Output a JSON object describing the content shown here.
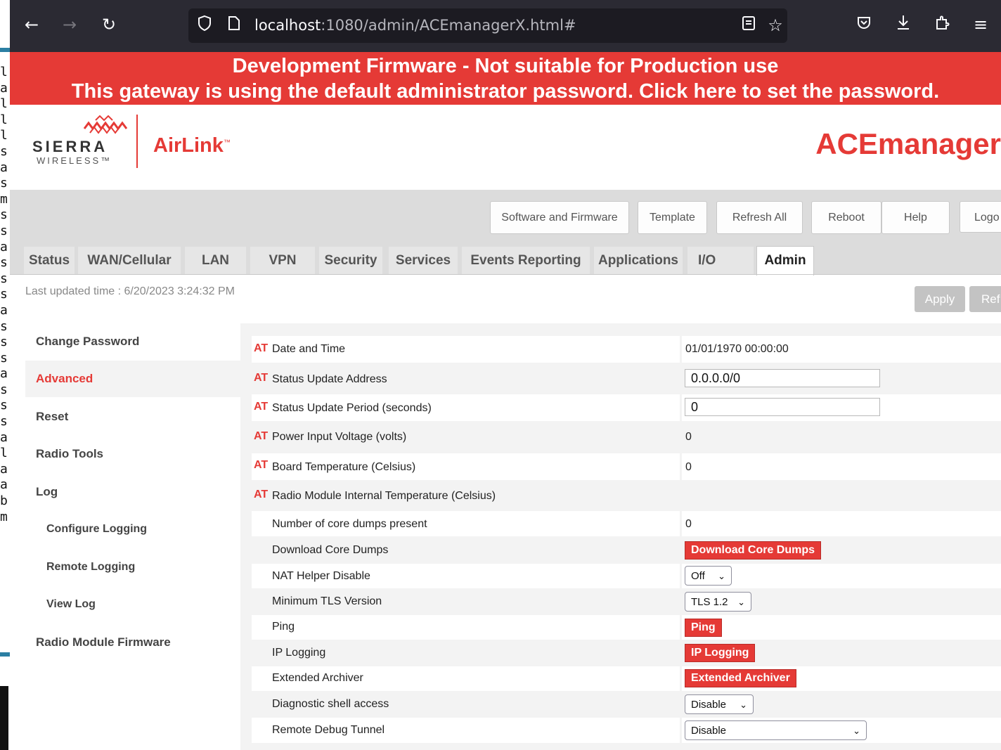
{
  "terminal": {
    "chars": "l\na\nl\nl\nl\ns\na\ns\nm\ns\ns\na\ns\ns\ns\na\ns\ns\ns\na\ns\ns\ns\na\nl\na\na\nb\nm"
  },
  "browser": {
    "url_host": "localhost",
    "url_path": ":1080/admin/ACEmanagerX.html#"
  },
  "banner": {
    "line1": "Development Firmware - Not suitable for Production use",
    "line2": "This gateway is using the default administrator password. Click here to set the password."
  },
  "logo": {
    "sierra": "SIERRA",
    "wireless": "WIRELESS™",
    "airlink": "AirLink",
    "airlink_tm": "™",
    "app": "ACEmanager"
  },
  "toolbar": {
    "software": "Software and Firmware",
    "template": "Template",
    "refresh_all": "Refresh All",
    "reboot": "Reboot",
    "help": "Help",
    "logout": "Logo"
  },
  "tabs": [
    "Status",
    "WAN/Cellular",
    "LAN",
    "VPN",
    "Security",
    "Services",
    "Events Reporting",
    "Applications",
    "I/O",
    "Admin"
  ],
  "last_updated": "Last updated time : 6/20/2023 3:24:32 PM",
  "actions": {
    "apply": "Apply",
    "refresh": "Ref"
  },
  "menu": [
    "Change Password",
    "Advanced",
    "Reset",
    "Radio Tools",
    "Log",
    "Configure Logging",
    "Remote Logging",
    "View Log",
    "Radio Module Firmware"
  ],
  "at": "AT",
  "rows": {
    "date_time": {
      "label": "Date and Time",
      "value": "01/01/1970 00:00:00"
    },
    "status_addr": {
      "label": "Status Update Address",
      "value": "0.0.0.0/0"
    },
    "status_period": {
      "label": "Status Update Period (seconds)",
      "value": "0"
    },
    "power_voltage": {
      "label": "Power Input Voltage (volts)",
      "value": "0"
    },
    "board_temp": {
      "label": "Board Temperature (Celsius)",
      "value": "0"
    },
    "radio_temp": {
      "label": "Radio Module Internal Temperature (Celsius)"
    },
    "core_dumps": {
      "label": "Number of core dumps present",
      "value": "0"
    },
    "download_dumps": {
      "label": "Download Core Dumps",
      "button": "Download Core Dumps"
    },
    "nat_helper": {
      "label": "NAT Helper Disable",
      "value": "Off"
    },
    "min_tls": {
      "label": "Minimum TLS Version",
      "value": "TLS 1.2"
    },
    "ping": {
      "label": "Ping",
      "button": "Ping"
    },
    "ip_logging": {
      "label": "IP Logging",
      "button": "IP Logging"
    },
    "ext_archiver": {
      "label": "Extended Archiver",
      "button": "Extended Archiver"
    },
    "diag_shell": {
      "label": "Diagnostic shell access",
      "value": "Disable"
    },
    "debug_tunnel": {
      "label": "Remote Debug Tunnel",
      "value": "Disable"
    }
  },
  "colors": {
    "accent": "#e53a36",
    "chrome": "#2b2a33",
    "gray": "#dcdcdc"
  }
}
